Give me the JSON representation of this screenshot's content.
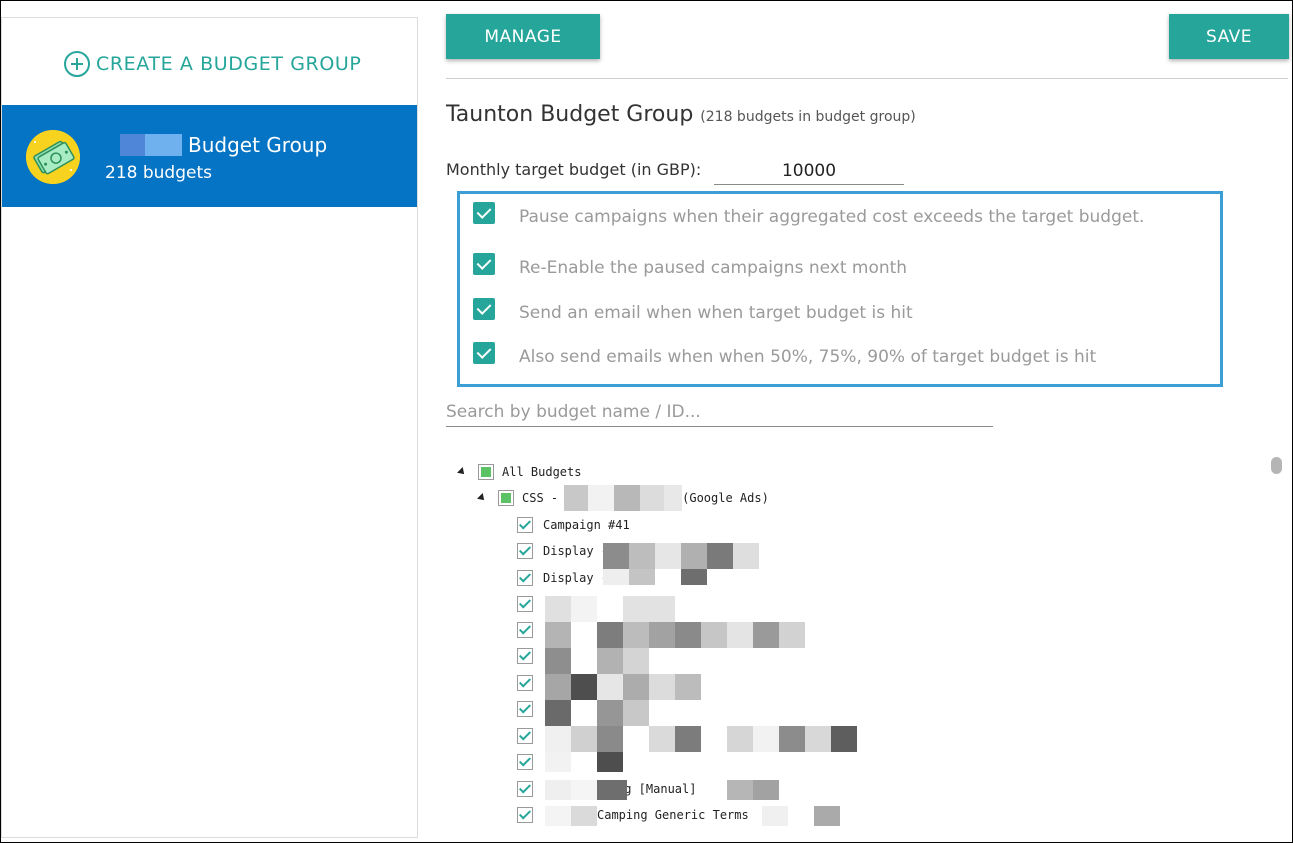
{
  "sidebar": {
    "create_label": "CREATE A BUDGET GROUP",
    "groups": [
      {
        "name": "Budget Group",
        "count": "218 budgets"
      }
    ]
  },
  "toolbar": {
    "manage_label": "MANAGE",
    "save_label": "SAVE"
  },
  "group": {
    "title": "Taunton Budget Group",
    "subtitle": "(218 budgets in budget group)",
    "monthly_label": "Monthly target budget (in GBP):",
    "monthly_value": "10000"
  },
  "options": [
    {
      "label": "Pause campaigns when their aggregated cost exceeds the target budget.",
      "checked": true
    },
    {
      "label": "Re-Enable the paused campaigns next month",
      "checked": true
    },
    {
      "label": "Send an email when when target budget is hit",
      "checked": true
    },
    {
      "label": "Also send emails when when 50%, 75%, 90% of target budget is hit",
      "checked": true
    }
  ],
  "search": {
    "placeholder": "Search by budget name / ID..."
  },
  "tree": {
    "root": "All Budgets",
    "account_prefix": "CSS -",
    "account_suffix": "(Google Ads)",
    "items": [
      "Campaign #41",
      "Display -",
      "Display -",
      "",
      "",
      "",
      "",
      "",
      "",
      "",
      "rg [Manual]",
      "Camping Generic Terms"
    ]
  },
  "colors": {
    "accent": "#26a69a",
    "selected": "#0574c4",
    "options_border": "#3b9fd6"
  }
}
